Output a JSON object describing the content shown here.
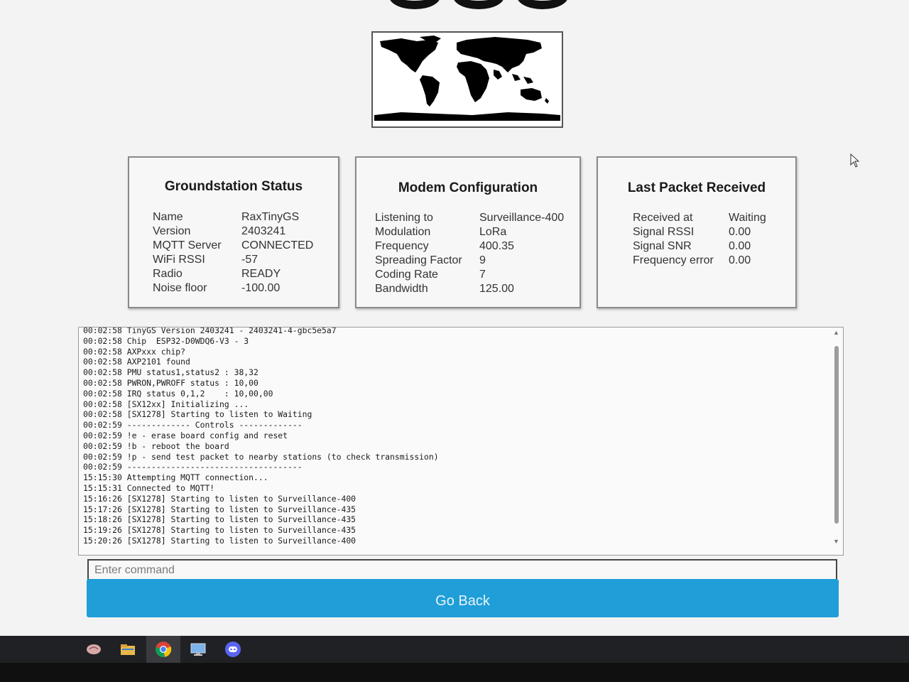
{
  "status_card": {
    "title": "Groundstation Status",
    "rows": [
      {
        "label": "Name",
        "value": "RaxTinyGS"
      },
      {
        "label": "Version",
        "value": "2403241"
      },
      {
        "label": "MQTT Server",
        "value": "CONNECTED"
      },
      {
        "label": "WiFi RSSI",
        "value": "-57"
      },
      {
        "label": "Radio",
        "value": "READY"
      },
      {
        "label": "Noise floor",
        "value": "-100.00"
      }
    ]
  },
  "modem_card": {
    "title": "Modem Configuration",
    "rows": [
      {
        "label": "Listening to",
        "value": "Surveillance-400"
      },
      {
        "label": "Modulation",
        "value": "LoRa"
      },
      {
        "label": "Frequency",
        "value": "400.35"
      },
      {
        "label": "Spreading Factor",
        "value": "9"
      },
      {
        "label": "Coding Rate",
        "value": "7"
      },
      {
        "label": "Bandwidth",
        "value": "125.00"
      }
    ]
  },
  "packet_card": {
    "title": "Last Packet Received",
    "rows": [
      {
        "label": "Received at",
        "value": "Waiting"
      },
      {
        "label": "Signal RSSI",
        "value": "0.00"
      },
      {
        "label": "Signal SNR",
        "value": "0.00"
      },
      {
        "label": "Frequency error",
        "value": "0.00"
      }
    ]
  },
  "console": {
    "lines": [
      "00:02:58 TinyGS Version 2403241 - 2403241-4-gbc5e5a7",
      "00:02:58 Chip  ESP32-D0WDQ6-V3 - 3",
      "00:02:58 AXPxxx chip?",
      "00:02:58 AXP2101 found",
      "00:02:58 PMU status1,status2 : 38,32",
      "00:02:58 PWRON,PWROFF status : 10,00",
      "00:02:58 IRQ status 0,1,2    : 10,00,00",
      "00:02:58 [SX12xx] Initializing ...",
      "00:02:58 [SX1278] Starting to listen to Waiting",
      "00:02:59 ------------- Controls -------------",
      "00:02:59 !e - erase board config and reset",
      "00:02:59 !b - reboot the board",
      "00:02:59 !p - send test packet to nearby stations (to check transmission)",
      "00:02:59 ------------------------------------",
      "15:15:30 Attempting MQTT connection...",
      "15:15:31 Connected to MQTT!",
      "15:16:26 [SX1278] Starting to listen to Surveillance-400",
      "15:17:26 [SX1278] Starting to listen to Surveillance-435",
      "15:18:26 [SX1278] Starting to listen to Surveillance-435",
      "15:19:26 [SX1278] Starting to listen to Surveillance-435",
      "15:20:26 [SX1278] Starting to listen to Surveillance-400"
    ]
  },
  "command_input": {
    "placeholder": "Enter command",
    "value": ""
  },
  "go_back_label": "Go Back",
  "taskbar": {
    "icons": [
      "brain-app-icon",
      "folder-icon",
      "chrome-icon",
      "remote-desktop-icon",
      "discord-icon"
    ],
    "active_index": 2
  },
  "colors": {
    "button": "#1f9ed8",
    "taskbar": "#202124"
  }
}
